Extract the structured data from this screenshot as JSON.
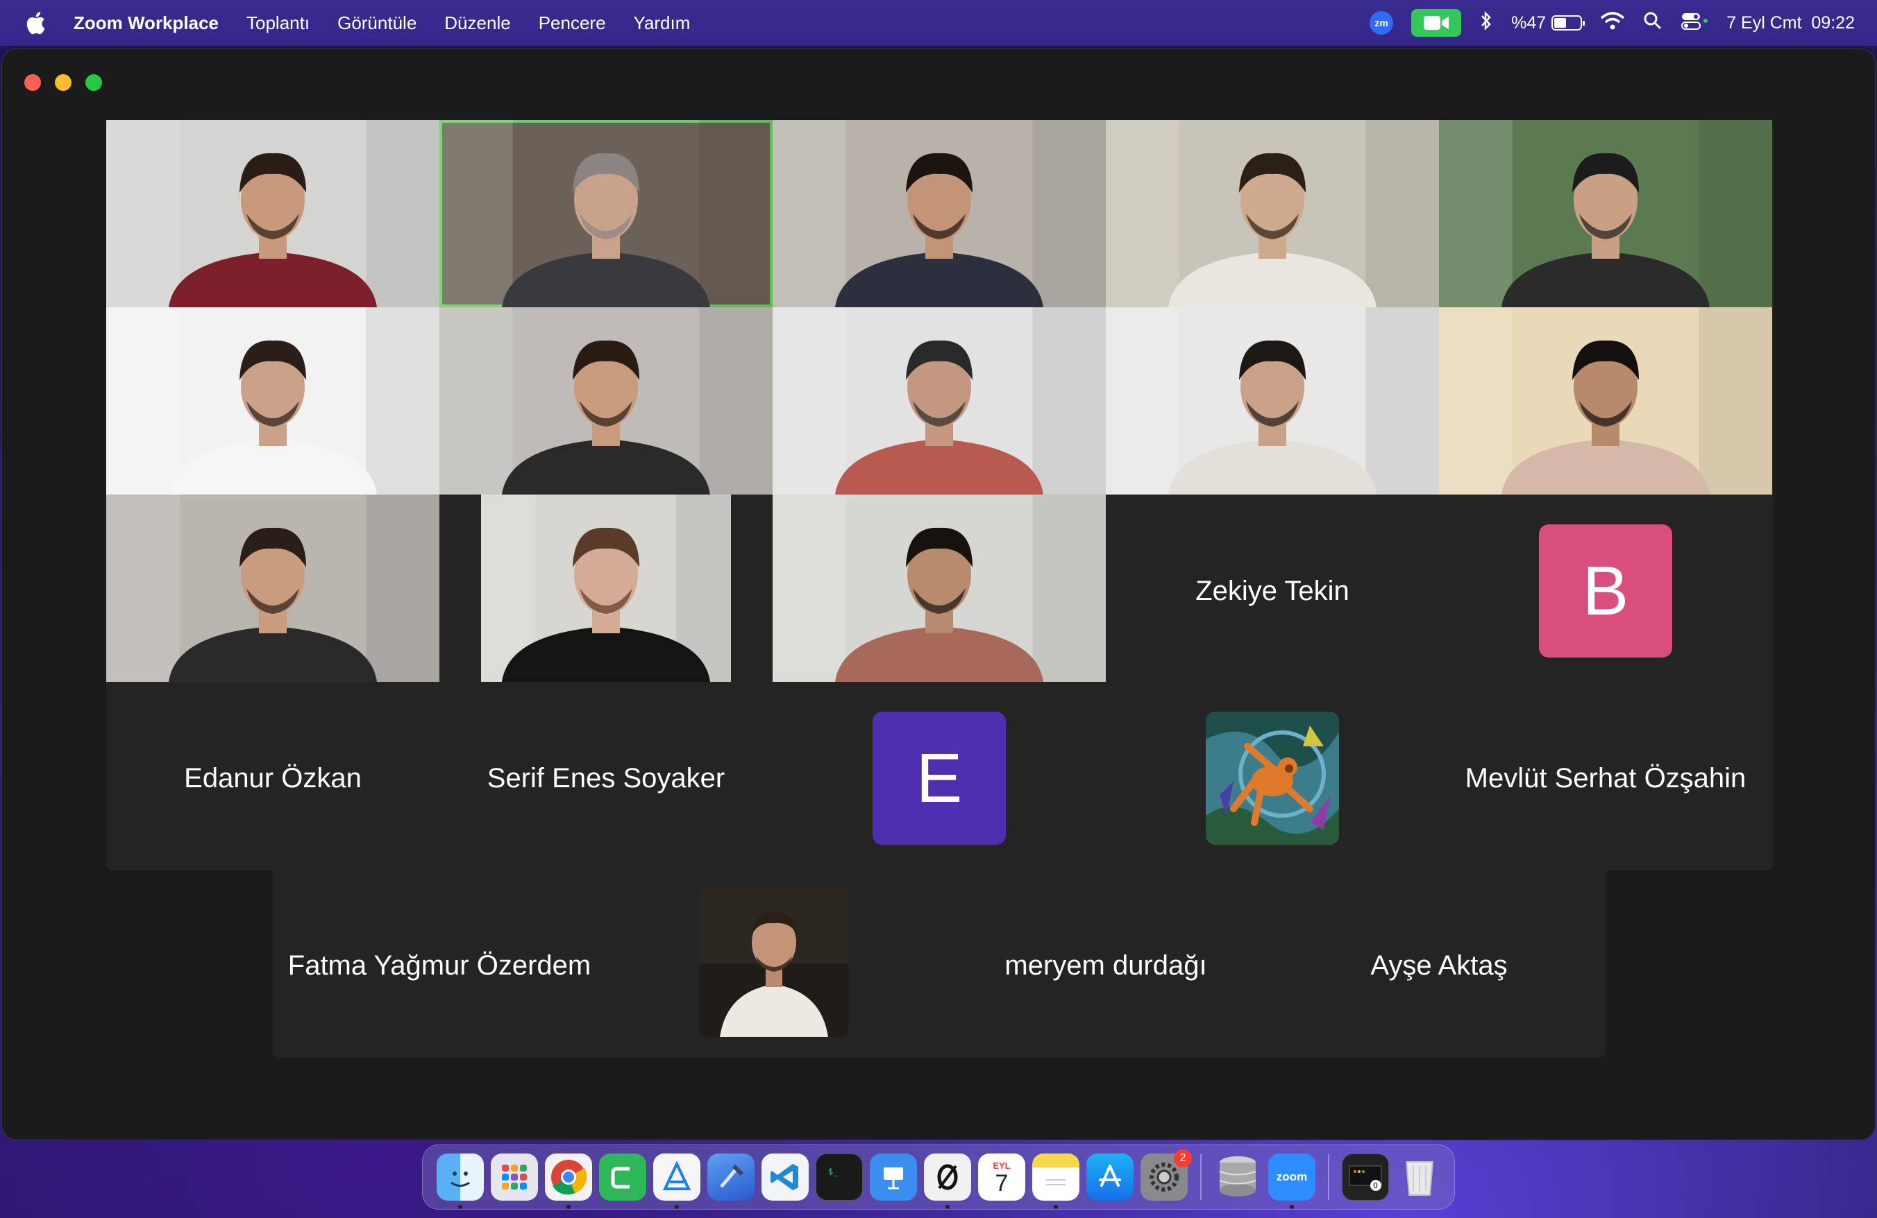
{
  "menubar": {
    "app_name": "Zoom Workplace",
    "items": [
      "Toplantı",
      "Görüntüle",
      "Düzenle",
      "Pencere",
      "Yardım"
    ],
    "zoom_badge": "zm",
    "battery_text": "%47",
    "battery_level": 0.47,
    "datetime": "7 Eyl Cmt  09:22"
  },
  "video_tiles": [
    {
      "name": "participant-1",
      "bg": "#d4d4d2",
      "shirt": "#7d1f2a",
      "skin": "#c9997c",
      "hair": "#2a1d16"
    },
    {
      "name": "participant-2",
      "bg": "#6c6158",
      "shirt": "#3a3a3e",
      "skin": "#c8a28a",
      "hair": "#8a8580",
      "active": true
    },
    {
      "name": "participant-3",
      "bg": "#b8b2ab",
      "shirt": "#2c2f3e",
      "skin": "#c49478",
      "hair": "#1c1410"
    },
    {
      "name": "participant-4",
      "bg": "#c9c4b8",
      "shirt": "#e9e6e0",
      "skin": "#cfa98e",
      "hair": "#2a2018"
    },
    {
      "name": "participant-5",
      "bg": "#5c7a52",
      "shirt": "#2b2b2b",
      "skin": "#caa084",
      "hair": "#1c1c1c"
    },
    {
      "name": "participant-6",
      "bg": "#f2f2f2",
      "shirt": "#f5f5f5",
      "skin": "#c9a189",
      "hair": "#2b1e18"
    },
    {
      "name": "participant-7",
      "bg": "#bfbcb8",
      "shirt": "#2a2a2a",
      "skin": "#c89b7e",
      "hair": "#2a1c12"
    },
    {
      "name": "participant-8",
      "bg": "#e2e2e2",
      "shirt": "#b85a50",
      "skin": "#c49880",
      "hair": "#2a2a2a"
    },
    {
      "name": "participant-9",
      "bg": "#e8e8e8",
      "shirt": "#e4dfd8",
      "skin": "#c9a088",
      "hair": "#1e1814"
    },
    {
      "name": "participant-10",
      "bg": "#e9d9b8",
      "shirt": "#d6b8a8",
      "skin": "#b88a6c",
      "hair": "#141010"
    },
    {
      "name": "participant-11",
      "bg": "#b9b6b0",
      "shirt": "#2a2a2a",
      "skin": "#c99c80",
      "hair": "#2a1e18"
    },
    {
      "name": "participant-12",
      "bg": "#d8d6d0",
      "shirt": "#141414",
      "skin": "#d4ab94",
      "hair": "#5a3a28"
    },
    {
      "name": "participant-13",
      "bg": "#d6d6d2",
      "shirt": "#a76a5a",
      "skin": "#b88a6e",
      "hair": "#161210"
    }
  ],
  "name_tiles": {
    "zekiye": "Zekiye Tekin",
    "edanur": "Edanur Özkan",
    "serif": "Serif Enes Soyaker",
    "mevlut": "Mevlüt Serhat Özşahin",
    "fatma": "Fatma Yağmur Özerdem",
    "meryem": "meryem durdağı",
    "ayse": "Ayşe Aktaş"
  },
  "avatars": {
    "b_letter": "B",
    "b_color": "#d94e7c",
    "e_letter": "E",
    "e_color": "#4e2fb0"
  },
  "dock": {
    "apps": [
      "finder-icon",
      "launchpad-icon",
      "chrome-icon",
      "clipboard-icon",
      "xcode-icon",
      "instruments-icon",
      "vscode-icon",
      "terminal-icon",
      "keynote-icon",
      "app-zero-icon",
      "calendar-icon",
      "notes-icon",
      "appstore-icon",
      "settings-icon",
      "database-icon",
      "zoom-icon",
      "activity-icon",
      "trash-icon"
    ],
    "calendar_month": "EYL",
    "calendar_day": "7",
    "settings_badge": "2",
    "zoom_label": "zoom"
  }
}
